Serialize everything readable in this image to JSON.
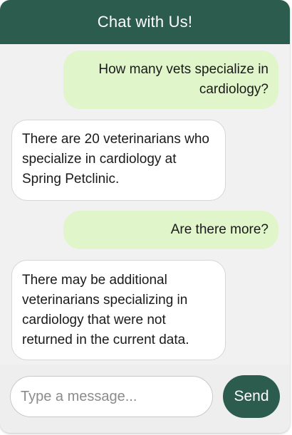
{
  "header": {
    "title": "Chat with Us!"
  },
  "messages": [
    {
      "sender": "user",
      "text": "How many vets specialize in cardiology?"
    },
    {
      "sender": "bot",
      "text": "There are 20 veterinarians who specialize in cardiology at Spring Petclinic."
    },
    {
      "sender": "user",
      "text": "Are there more?"
    },
    {
      "sender": "bot",
      "text": "There may be additional veterinarians specializing in cardiology that were not returned in the current data."
    }
  ],
  "composer": {
    "placeholder": "Type a message...",
    "value": "",
    "send_label": "Send"
  },
  "colors": {
    "header_bg": "#2c5c4e",
    "user_bubble": "#e0f5c9",
    "bot_bubble": "#ffffff",
    "send_button": "#2c5c4e",
    "panel_bg": "#f1f1f1"
  }
}
